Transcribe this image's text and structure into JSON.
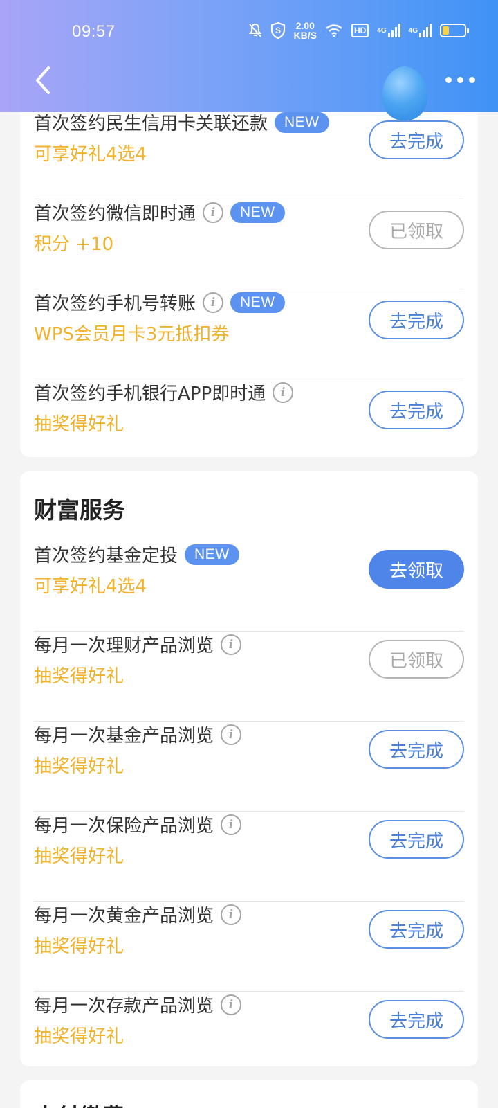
{
  "status_bar": {
    "time": "09:57",
    "net_speed_value": "2.00",
    "net_speed_unit": "KB/S",
    "hd_label": "HD",
    "net1": "4G",
    "net2": "4G"
  },
  "header": {
    "back_icon": "chevron-left-icon",
    "more_icon": "more-dots-icon"
  },
  "section1": {
    "rows": [
      {
        "title": "首次签约民生信用卡关联还款",
        "has_info": false,
        "badge": "NEW",
        "sub": "可享好礼4选4",
        "button": "去完成",
        "state": "todo"
      },
      {
        "title": "首次签约微信即时通",
        "has_info": true,
        "badge": "NEW",
        "sub": "积分 +10",
        "button": "已领取",
        "state": "done"
      },
      {
        "title": "首次签约手机号转账",
        "has_info": true,
        "badge": "NEW",
        "sub": "WPS会员月卡3元抵扣券",
        "button": "去完成",
        "state": "todo"
      },
      {
        "title": "首次签约手机银行APP即时通",
        "has_info": true,
        "badge": "",
        "sub": "抽奖得好礼",
        "button": "去完成",
        "state": "todo"
      }
    ]
  },
  "section2": {
    "title": "财富服务",
    "rows": [
      {
        "title": "首次签约基金定投",
        "has_info": false,
        "badge": "NEW",
        "sub": "可享好礼4选4",
        "button": "去领取",
        "state": "claim"
      },
      {
        "title": "每月一次理财产品浏览",
        "has_info": true,
        "badge": "",
        "sub": "抽奖得好礼",
        "button": "已领取",
        "state": "done"
      },
      {
        "title": "每月一次基金产品浏览",
        "has_info": true,
        "badge": "",
        "sub": "抽奖得好礼",
        "button": "去完成",
        "state": "todo"
      },
      {
        "title": "每月一次保险产品浏览",
        "has_info": true,
        "badge": "",
        "sub": "抽奖得好礼",
        "button": "去完成",
        "state": "todo"
      },
      {
        "title": "每月一次黄金产品浏览",
        "has_info": true,
        "badge": "",
        "sub": "抽奖得好礼",
        "button": "去完成",
        "state": "todo"
      },
      {
        "title": "每月一次存款产品浏览",
        "has_info": true,
        "badge": "",
        "sub": "抽奖得好礼",
        "button": "去完成",
        "state": "todo"
      }
    ]
  },
  "section3": {
    "title": "支付缴费"
  },
  "colors": {
    "accent_blue": "#4f85e8",
    "reward_orange": "#f1b22a",
    "badge_blue": "#5d93f0"
  }
}
